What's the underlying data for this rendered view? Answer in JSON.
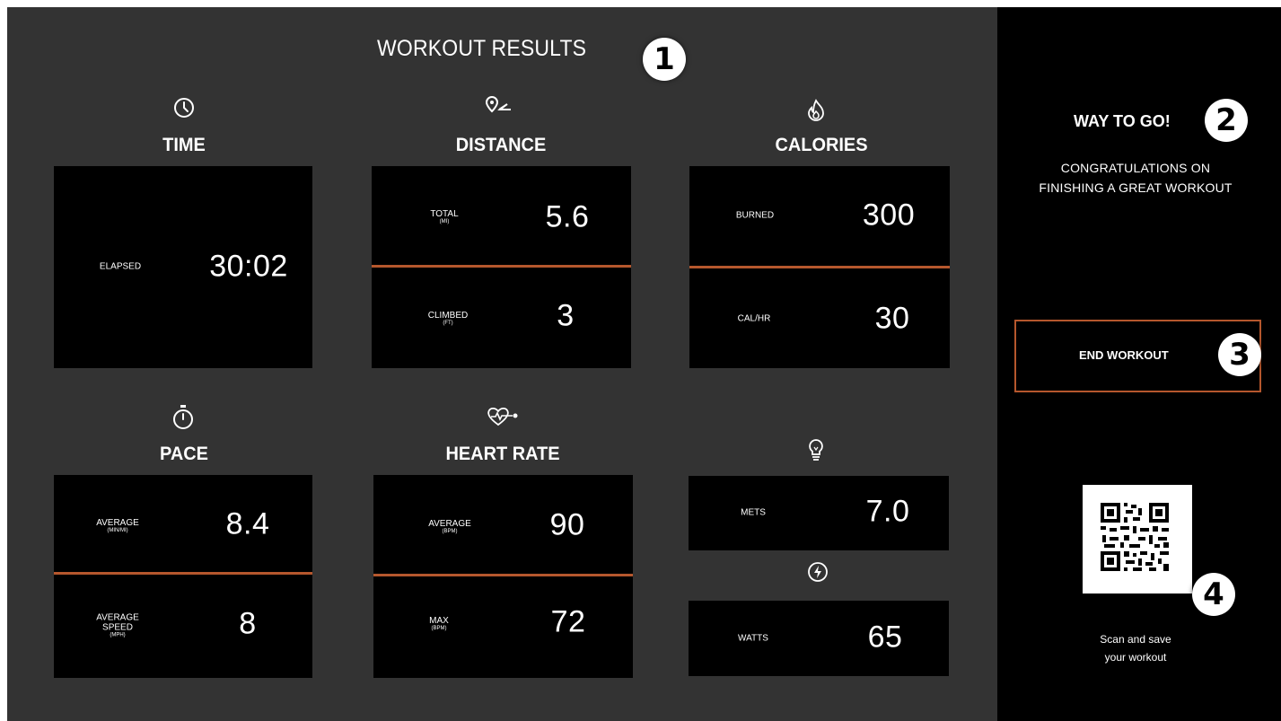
{
  "header": {
    "title": "WORKOUT RESULTS"
  },
  "badges": {
    "one": "1",
    "two": "2",
    "three": "3",
    "four": "4"
  },
  "sections": {
    "time": {
      "label": "TIME",
      "icon": "clock-icon",
      "elapsed_label": "ELAPSED",
      "elapsed_value": "30:02"
    },
    "distance": {
      "label": "DISTANCE",
      "icon": "location-route-icon",
      "total_label": "TOTAL",
      "total_unit": "(MI)",
      "total_value": "5.6",
      "climbed_label": "CLIMBED",
      "climbed_unit": "(FT)",
      "climbed_value": "3"
    },
    "calories": {
      "label": "CALORIES",
      "icon": "flame-icon",
      "burned_label": "BURNED",
      "burned_value": "300",
      "calhr_label": "CAL/HR",
      "calhr_value": "30"
    },
    "pace": {
      "label": "PACE",
      "icon": "stopwatch-icon",
      "avg_label": "AVERAGE",
      "avg_unit": "(MIN/MI)",
      "avg_value": "8.4",
      "speed_label_1": "AVERAGE",
      "speed_label_2": "SPEED",
      "speed_unit": "(MPH)",
      "speed_value": "8"
    },
    "heart_rate": {
      "label": "HEART RATE",
      "icon": "heart-rate-icon",
      "avg_label": "AVERAGE",
      "avg_unit": "(BPM)",
      "avg_value": "90",
      "max_label": "MAX",
      "max_unit": "(BPM)",
      "max_value": "72"
    },
    "mets": {
      "icon": "lightbulb-icon",
      "label": "METS",
      "value": "7.0"
    },
    "watts": {
      "icon": "lightning-icon",
      "label": "WATTS",
      "value": "65"
    }
  },
  "sidebar": {
    "title": "WAY TO GO!",
    "message": "CONGRATULATIONS ON FINISHING A GREAT WORKOUT",
    "end_button": "END WORKOUT",
    "qr_icon": "qr-code-icon",
    "scan_line1": "Scan and save",
    "scan_line2": "your workout"
  },
  "colors": {
    "accent": "#b5572d",
    "panel": "#000000",
    "background": "#333333"
  }
}
